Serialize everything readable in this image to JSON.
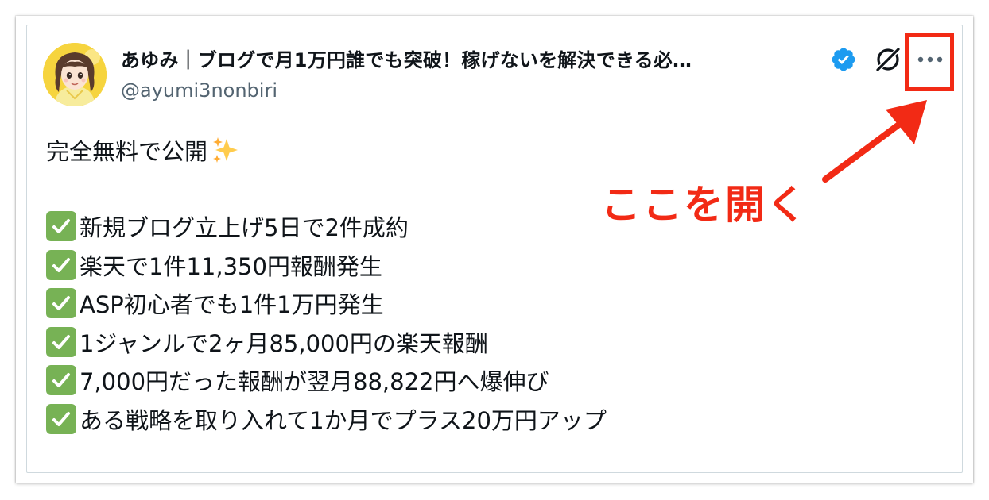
{
  "tweet": {
    "display_name": "あゆみ｜ブログで月1万円誰でも突破！稼げないを解決できる必…",
    "handle": "@ayumi3nonbiri",
    "intro": "完全無料で公開",
    "items": [
      "新規ブログ立上げ5日で2件成約",
      "楽天で1件11,350円報酬発生",
      "ASP初心者でも1件1万円発生",
      "1ジャンルで2ヶ月85,000円の楽天報酬",
      "7,000円だった報酬が翌月88,822円へ爆伸び",
      "ある戦略を取り入れて1か月でプラス20万円アップ"
    ]
  },
  "annotation": {
    "label": "ここを開く",
    "color": "#f22a15"
  },
  "icons": {
    "verified": "verified-badge-icon",
    "grok": "grok-icon",
    "more": "more-options-icon",
    "sparkles": "sparkles-emoji",
    "check": "check-mark-button-emoji"
  },
  "colors": {
    "text": "#0f1419",
    "secondary": "#536471",
    "verified": "#1d9bf0",
    "check": "#77b255"
  }
}
